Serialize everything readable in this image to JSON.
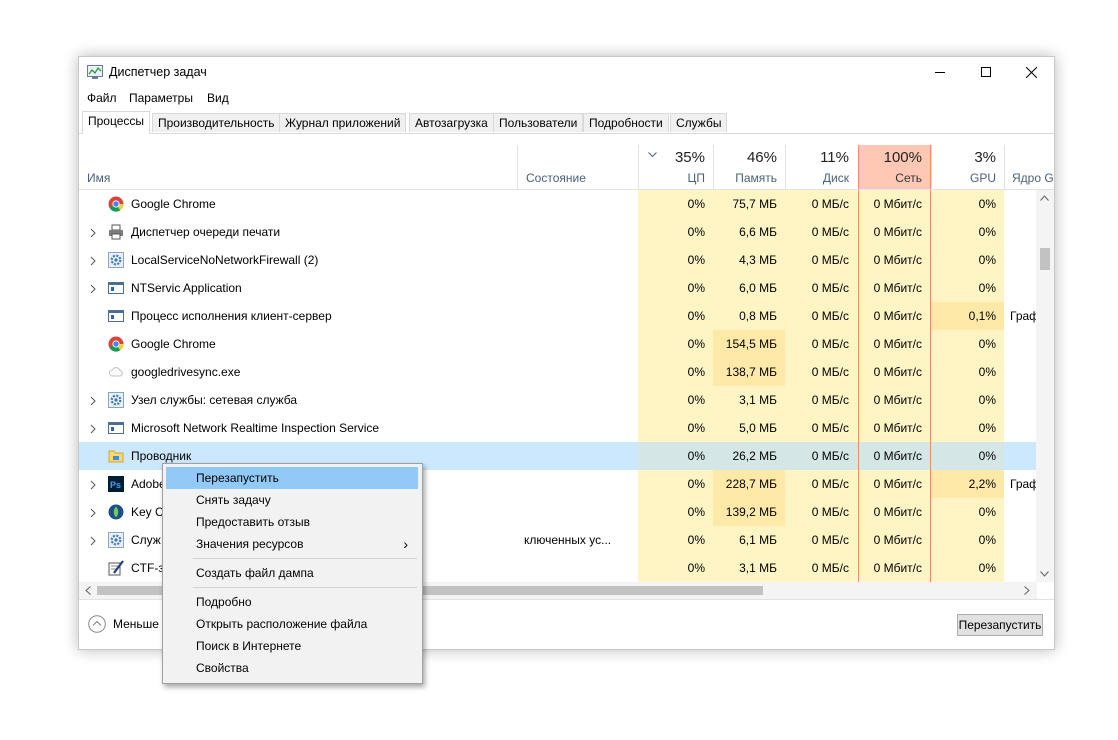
{
  "window": {
    "title": "Диспетчер задач"
  },
  "menubar": [
    "Файл",
    "Параметры",
    "Вид"
  ],
  "tabs": [
    "Процессы",
    "Производительность",
    "Журнал приложений",
    "Автозагрузка",
    "Пользователи",
    "Подробности",
    "Службы"
  ],
  "columns": {
    "name": "Имя",
    "state": "Состояние",
    "cpu": {
      "pct": "35%",
      "label": "ЦП"
    },
    "mem": {
      "pct": "46%",
      "label": "Память"
    },
    "disk": {
      "pct": "11%",
      "label": "Диск"
    },
    "net": {
      "pct": "100%",
      "label": "Сеть"
    },
    "gpu": {
      "pct": "3%",
      "label": "GPU"
    },
    "gpu_engine": {
      "label": "Ядро GP"
    }
  },
  "rows": [
    {
      "name": "Google Chrome",
      "icon": "chrome-icon",
      "expand": false,
      "state": "",
      "cpu": "0%",
      "mem": "75,7 МБ",
      "disk": "0 МБ/с",
      "net": "0 Мбит/с",
      "gpu": "0%",
      "engine": ""
    },
    {
      "name": "Диспетчер очереди печати",
      "icon": "printer-icon",
      "expand": true,
      "state": "",
      "cpu": "0%",
      "mem": "6,6 МБ",
      "disk": "0 МБ/с",
      "net": "0 Мбит/с",
      "gpu": "0%",
      "engine": ""
    },
    {
      "name": "LocalServiceNoNetworkFirewall (2)",
      "icon": "gear-icon",
      "expand": true,
      "state": "",
      "cpu": "0%",
      "mem": "4,3 МБ",
      "disk": "0 МБ/с",
      "net": "0 Мбит/с",
      "gpu": "0%",
      "engine": ""
    },
    {
      "name": "NTServic Application",
      "icon": "app-window-icon",
      "expand": true,
      "state": "",
      "cpu": "0%",
      "mem": "6,0 МБ",
      "disk": "0 МБ/с",
      "net": "0 Мбит/с",
      "gpu": "0%",
      "engine": ""
    },
    {
      "name": "Процесс исполнения клиент-сервер",
      "icon": "app-window-icon",
      "expand": false,
      "state": "",
      "cpu": "0%",
      "mem": "0,8 МБ",
      "disk": "0 МБ/с",
      "net": "0 Мбит/с",
      "gpu": "0,1%",
      "engine": "Граф"
    },
    {
      "name": "Google Chrome",
      "icon": "chrome-icon",
      "expand": false,
      "state": "",
      "cpu": "0%",
      "mem": "154,5 МБ",
      "disk": "0 МБ/с",
      "net": "0 Мбит/с",
      "gpu": "0%",
      "engine": ""
    },
    {
      "name": "googledrivesync.exe",
      "icon": "cloud-icon",
      "expand": false,
      "state": "",
      "cpu": "0%",
      "mem": "138,7 МБ",
      "disk": "0 МБ/с",
      "net": "0 Мбит/с",
      "gpu": "0%",
      "engine": ""
    },
    {
      "name": "Узел службы: сетевая служба",
      "icon": "gear-icon",
      "expand": true,
      "state": "",
      "cpu": "0%",
      "mem": "3,1 МБ",
      "disk": "0 МБ/с",
      "net": "0 Мбит/с",
      "gpu": "0%",
      "engine": ""
    },
    {
      "name": "Microsoft Network Realtime Inspection Service",
      "icon": "app-window-icon",
      "expand": true,
      "state": "",
      "cpu": "0%",
      "mem": "5,0 МБ",
      "disk": "0 МБ/с",
      "net": "0 Мбит/с",
      "gpu": "0%",
      "engine": ""
    },
    {
      "name": "Проводник",
      "icon": "folder-icon",
      "expand": false,
      "state": "",
      "cpu": "0%",
      "mem": "26,2 МБ",
      "disk": "0 МБ/с",
      "net": "0 Мбит/с",
      "gpu": "0%",
      "engine": ""
    },
    {
      "name": "Adobe",
      "icon": "photoshop-icon",
      "expand": true,
      "state": "",
      "cpu": "0%",
      "mem": "228,7 МБ",
      "disk": "0 МБ/с",
      "net": "0 Мбит/с",
      "gpu": "2,2%",
      "engine": "Граф"
    },
    {
      "name": "Key C",
      "icon": "key-icon",
      "expand": true,
      "state": "",
      "cpu": "0%",
      "mem": "139,2 МБ",
      "disk": "0 МБ/с",
      "net": "0 Мбит/с",
      "gpu": "0%",
      "engine": ""
    },
    {
      "name": "Служ",
      "icon": "gear-icon",
      "expand": true,
      "state": "ключенных ус...",
      "cpu": "0%",
      "mem": "6,1 МБ",
      "disk": "0 МБ/с",
      "net": "0 Мбит/с",
      "gpu": "0%",
      "engine": ""
    },
    {
      "name": "CTF-з",
      "icon": "pen-icon",
      "expand": false,
      "state": "",
      "cpu": "0%",
      "mem": "3,1 МБ",
      "disk": "0 МБ/с",
      "net": "0 Мбит/с",
      "gpu": "0%",
      "engine": ""
    }
  ],
  "footer": {
    "less": "Меньше",
    "restart_button": "Перезапустить"
  },
  "context_menu": {
    "items": [
      "Перезапустить",
      "Снять задачу",
      "Предоставить отзыв",
      "Значения ресурсов",
      "Создать файл дампа",
      "Подробно",
      "Открыть расположение файла",
      "Поиск в Интернете",
      "Свойства"
    ],
    "submenu_arrow": "›"
  },
  "colors": {
    "heat_light": "#fff4c4",
    "heat_med": "#ffe9a8",
    "net_header": "#ffc8b4",
    "net_border": "#f08c6c",
    "selected_row": "#cce8ff",
    "menu_highlight": "#91c9f7"
  }
}
